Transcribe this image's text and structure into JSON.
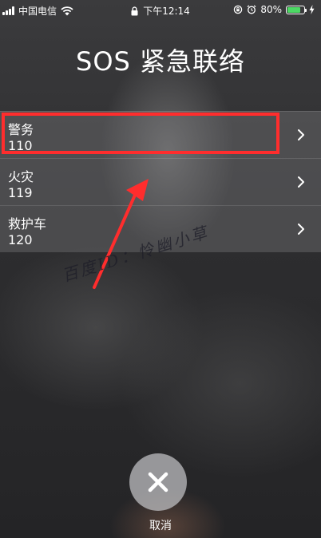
{
  "status_bar": {
    "carrier": "中国电信",
    "time": "下午12:14",
    "battery": "80%",
    "battery_level": 0.8,
    "icons": [
      "signal-icon",
      "wifi-icon",
      "lock-icon",
      "rotation-lock-icon",
      "alarm-icon",
      "battery-icon",
      "charging-icon"
    ]
  },
  "title": "SOS 紧急联络",
  "contacts": [
    {
      "name": "警务",
      "number": "110"
    },
    {
      "name": "火灾",
      "number": "119"
    },
    {
      "name": "救护车",
      "number": "120"
    }
  ],
  "cancel": {
    "label": "取消",
    "icon": "close-icon"
  },
  "annotation": {
    "watermark": "百度ID：怜幽小草",
    "highlight_color": "#ff2d2d"
  },
  "colors": {
    "battery_fill": "#4cd964",
    "annotation_red": "#ff2d2d"
  }
}
